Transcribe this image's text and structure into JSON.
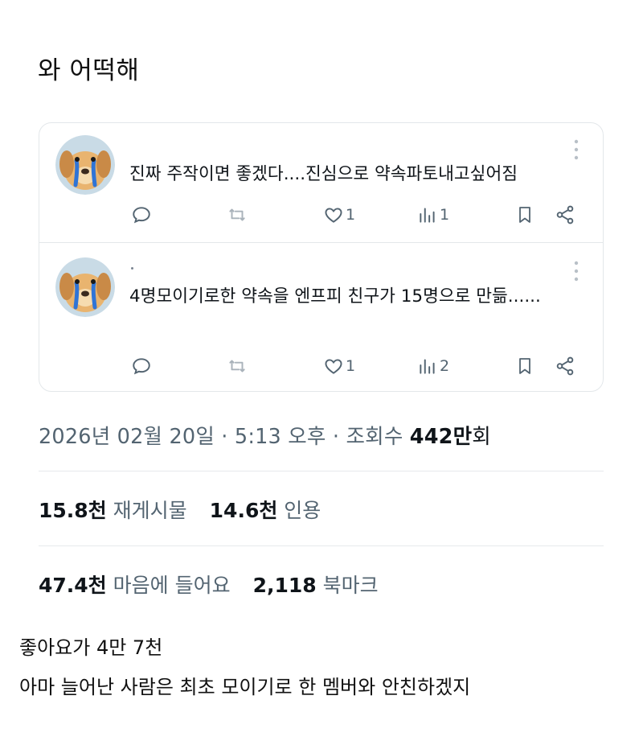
{
  "headline": "와 어떡해",
  "replies": [
    {
      "text": "진짜 주작이면 좋겠다....진심으로 약속파토내고싶어짐",
      "likes": "1",
      "views": "1"
    },
    {
      "text": "4명모이기로한 약속을 엔프피 친구가 15명으로 만듦......",
      "likes": "1",
      "views": "2"
    }
  ],
  "icons": {
    "reply": "reply-icon",
    "retweet": "retweet-icon",
    "like": "heart-icon",
    "views": "views-icon",
    "bookmark": "bookmark-icon",
    "share": "share-icon",
    "more": "more-icon"
  },
  "meta": {
    "datetime": "2026년 02월 20일 · 5:13 오후 · 조회수 ",
    "views_num": "442만",
    "views_unit": "회"
  },
  "stats": {
    "reposts_num": "15.8천",
    "reposts_label": "재게시물",
    "quotes_num": "14.6천",
    "quotes_label": "인용",
    "likes_num": "47.4천",
    "likes_label": "마음에 들어요",
    "bookmarks_num": "2,118",
    "bookmarks_label": "북마크"
  },
  "comments": [
    "좋아요가 4만 7천",
    "아마 늘어난 사람은 최초 모이기로 한 멤버와 안친하겠지"
  ],
  "colors": {
    "text": "#0f1419",
    "muted": "#536471",
    "border": "#e3e7ea"
  }
}
